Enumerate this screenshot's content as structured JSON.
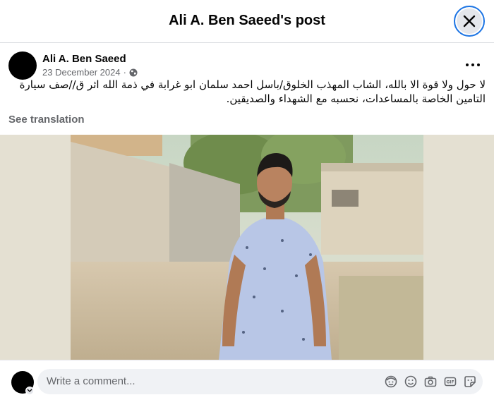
{
  "header": {
    "title": "Ali A. Ben Saeed's post"
  },
  "post": {
    "author": "Ali A. Ben Saeed",
    "date": "23 December 2024",
    "separator": "·",
    "text_line1": "لا حول ولا قوة الا بالله، الشاب المهذب الخلوق/باسل احمد سلمان ابو غرابة  في ذمة الله اثر ق//صف سيارة",
    "text_line2": "التامين الخاصة بالمساعدات، نحسبه مع الشهداء والصديقين.",
    "see_translation": "See translation"
  },
  "comment_box": {
    "placeholder": "Write a comment..."
  },
  "icons": {
    "close": "close-icon",
    "more": "more-options-icon",
    "privacy": "globe-icon",
    "avatar_sticker": "avatar-sticker-icon",
    "emoji": "emoji-icon",
    "camera": "camera-icon",
    "gif": "gif-icon",
    "sticker": "sticker-icon"
  },
  "colors": {
    "accent": "#1b74e4",
    "secondary_text": "#65676b",
    "input_bg": "#f0f2f5"
  }
}
